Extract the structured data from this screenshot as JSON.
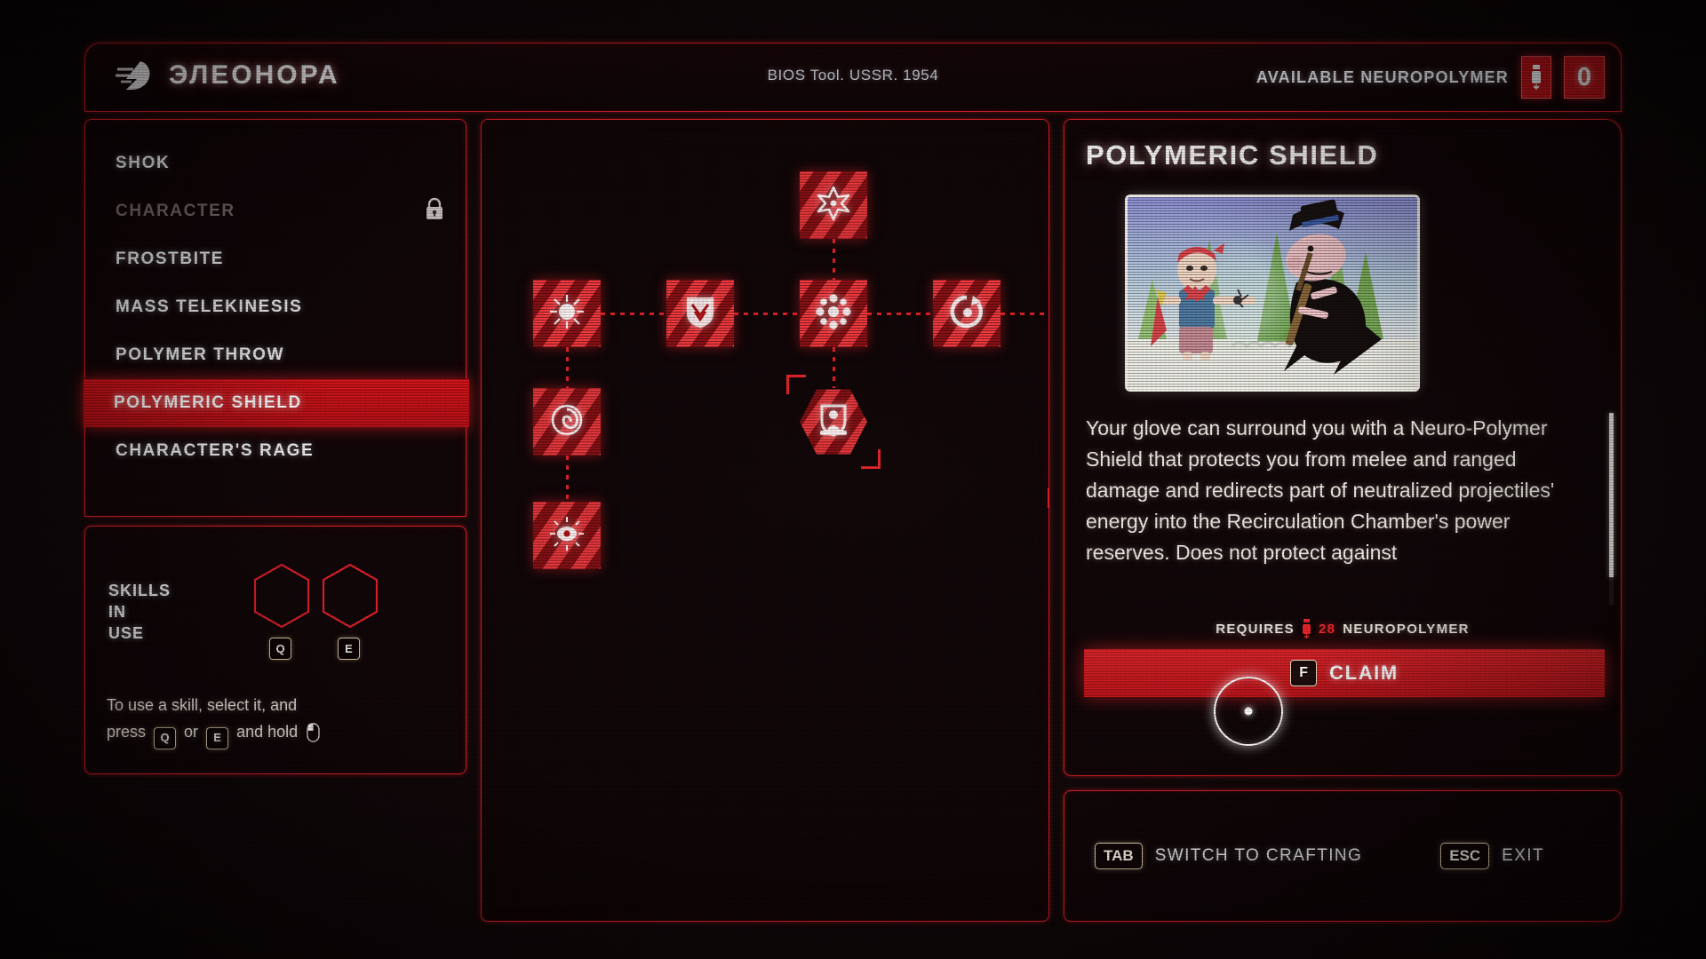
{
  "header": {
    "logo_icon": "glove-lightning-logo",
    "title": "ЭЛЕОНОРА",
    "bios_label": "BIOS Tool. USSR. 1954",
    "neuropolymer_label": "AVAILABLE NEUROPOLYMER",
    "neuropolymer_icon": "neuropolymer-vial-icon",
    "neuropolymer_count": "0"
  },
  "sidebar": {
    "items": [
      {
        "label": "SHOK",
        "state": "normal",
        "locked": false
      },
      {
        "label": "CHARACTER",
        "state": "locked",
        "locked": true
      },
      {
        "label": "FROSTBITE",
        "state": "normal",
        "locked": false
      },
      {
        "label": "MASS TELEKINESIS",
        "state": "normal",
        "locked": false
      },
      {
        "label": "POLYMER THROW",
        "state": "normal",
        "locked": false
      },
      {
        "label": "POLYMERIC SHIELD",
        "state": "selected",
        "locked": false
      },
      {
        "label": "CHARACTER'S RAGE",
        "state": "normal",
        "locked": false
      }
    ],
    "lock_icon": "padlock-icon"
  },
  "skills_in_use": {
    "label": "SKILLS\nIN\nUSE",
    "label_lines": [
      "SKILLS",
      "IN",
      "USE"
    ],
    "slots": [
      {
        "key": "Q",
        "filled": false
      },
      {
        "key": "E",
        "filled": false
      }
    ],
    "hint_parts": {
      "a": "To use a skill, select it, and",
      "b": "press",
      "key1": "Q",
      "c": "or",
      "key2": "E",
      "d": "and hold",
      "mouse_icon": "mouse-left-click-icon"
    }
  },
  "tree": {
    "nodes": [
      {
        "id": "n1",
        "icon": "six-point-star-icon",
        "shape": "square",
        "col": 2,
        "row": 0,
        "selected": false
      },
      {
        "id": "n2",
        "icon": "sunburst-icon",
        "shape": "square",
        "col": 0,
        "row": 1,
        "selected": false
      },
      {
        "id": "n3",
        "icon": "shield-crest-icon",
        "shape": "square",
        "col": 1,
        "row": 1,
        "selected": false
      },
      {
        "id": "n4",
        "icon": "polymer-burst-icon",
        "shape": "square",
        "col": 2,
        "row": 1,
        "selected": false
      },
      {
        "id": "n5",
        "icon": "recoil-circle-icon",
        "shape": "square",
        "col": 3,
        "row": 1,
        "selected": false
      },
      {
        "id": "n6",
        "icon": "magnet-hook-icon",
        "shape": "square",
        "col": 4,
        "row": 1,
        "selected": false
      },
      {
        "id": "n7",
        "icon": "spiral-vortex-icon",
        "shape": "square",
        "col": 0,
        "row": 2,
        "selected": false
      },
      {
        "id": "n8",
        "icon": "shield-figure-icon",
        "shape": "hex",
        "col": 2,
        "row": 2,
        "selected": true
      },
      {
        "id": "n9",
        "icon": "dome-shield-icon",
        "shape": "square",
        "col": 4,
        "row": 2,
        "selected": false
      },
      {
        "id": "n10",
        "icon": "radiant-eye-icon",
        "shape": "square",
        "col": 0,
        "row": 3,
        "selected": false
      },
      {
        "id": "n11",
        "icon": "armored-heart-icon",
        "shape": "square",
        "col": 4,
        "row": 3,
        "selected": true
      }
    ],
    "links": [
      {
        "from": "n1",
        "to": "n4",
        "dir": "v"
      },
      {
        "from": "n2",
        "to": "n3",
        "dir": "h"
      },
      {
        "from": "n3",
        "to": "n4",
        "dir": "h"
      },
      {
        "from": "n4",
        "to": "n5",
        "dir": "h"
      },
      {
        "from": "n5",
        "to": "n6",
        "dir": "h"
      },
      {
        "from": "n2",
        "to": "n7",
        "dir": "v"
      },
      {
        "from": "n4",
        "to": "n8",
        "dir": "v"
      },
      {
        "from": "n6",
        "to": "n9",
        "dir": "v"
      },
      {
        "from": "n7",
        "to": "n10",
        "dir": "v"
      },
      {
        "from": "n9",
        "to": "n11",
        "dir": "v"
      }
    ]
  },
  "detail": {
    "title": "POLYMERIC SHIELD",
    "thumbnail_alt": "soviet-cartoon-boy-shield-vs-pig-capitalist",
    "description": "Your glove can surround you with a Neuro-Polymer Shield that protects you from melee and ranged damage and redirects part of neutralized projectiles' energy into the Recirculation Chamber's power reserves. Does not protect against",
    "requires_label": "REQUIRES",
    "requires_icon": "neuropolymer-vial-icon",
    "requires_amount": "28",
    "requires_currency": "NEUROPOLYMER",
    "claim_key": "F",
    "claim_label": "CLAIM",
    "cursor_icon": "ring-cursor"
  },
  "footer": {
    "switch_key": "TAB",
    "switch_label": "SWITCH TO CRAFTING",
    "exit_key": "ESC",
    "exit_label": "EXIT"
  },
  "colors": {
    "accent_red": "#e01f26",
    "bright_red": "#f23a3f",
    "panel_bg": "#0c0405",
    "text_white": "#f3f4f6",
    "locked_grey": "#7c6e70"
  }
}
